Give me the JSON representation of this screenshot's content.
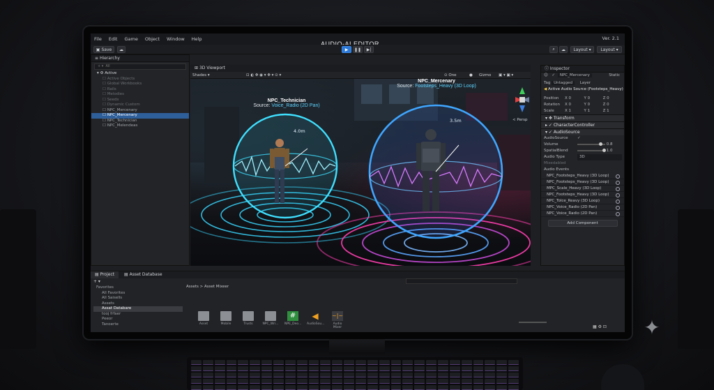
{
  "app": {
    "menu": [
      "File",
      "Edit",
      "Game",
      "Object",
      "Window",
      "Help"
    ],
    "title": "AUDIO-AI EDITOR",
    "version": "Ver. 2.1",
    "save_label": "Save",
    "layout_label": "Layout",
    "layer_label": "Layout"
  },
  "hierarchy": {
    "tab": "Hierarchy",
    "search_placeholder": "All",
    "root": "Active",
    "items": [
      {
        "label": "Active Objects",
        "style": "dim"
      },
      {
        "label": "Global Workbooks",
        "style": "dim"
      },
      {
        "label": "Rails",
        "style": "dim"
      },
      {
        "label": "Melodies",
        "style": "dim"
      },
      {
        "label": "Seeds",
        "style": "dim"
      },
      {
        "label": "Dynamic Custom",
        "style": "dim"
      },
      {
        "label": "NPC_Mercenary",
        "style": ""
      },
      {
        "label": "NPC_Mercenary",
        "style": "sel"
      },
      {
        "label": "NPC_Technician",
        "style": ""
      },
      {
        "label": "NPC_Melendeas",
        "style": ""
      }
    ]
  },
  "viewport": {
    "tab": "3D Viewport",
    "shading": "Shades",
    "tool_one": "One",
    "gizmos": "Gizmo",
    "persp": "< Persp",
    "npc1": {
      "name": "NPC_Technician",
      "source_prefix": "Source: ",
      "source": "Voice_Radio (2D Pan)",
      "distance": "4.0m"
    },
    "npc2": {
      "name": "NPC_Mercenary",
      "source_prefix": "Source: ",
      "source": "Footsteps_Heavy (3D Loop)",
      "distance": "3.5m"
    }
  },
  "inspector": {
    "tab": "Inspector",
    "object_name": "NPC_Mercenary",
    "static_label": "Static",
    "tag_label": "Tag",
    "tag_value": "Untagged",
    "layer_label": "Layer",
    "active_source": "Active Audio Source (Footsteps_Heavy)",
    "position": {
      "label": "Position",
      "x": "0",
      "y": "0",
      "z": "0"
    },
    "rotation": {
      "label": "Rotation",
      "x": "0",
      "y": "0",
      "z": "0"
    },
    "scale": {
      "label": "Scale",
      "x": "1",
      "y": "1",
      "z": "1"
    },
    "components": [
      "Transform",
      "CharacterController",
      "AudioSource"
    ],
    "audio_source_label": "AudioSource",
    "volume_label": "Volume",
    "volume_value": "0.8",
    "spatial_label": "SpatialBlend",
    "spatial_value": "1.0",
    "audio_type_label": "Audio Type",
    "audio_type_value": "3D",
    "mixed_label": "Mixedabled",
    "events_label": "Audio Events",
    "events": [
      "NPC_Footsteps_Heavy (3D Loop)",
      "NPC_Footsteps_Heavy (3D Loop)",
      "MPC_Scale_Heavy (3D Loop)",
      "NPC_Footsteps_Heavy (3D Loop)",
      "NPC_Tolce_Reavy (3D Loop)",
      "NPC_Voice_Radio (2D Pan)",
      "NPC_Voice_Radio (2D Pan)"
    ],
    "add_component": "Add Component"
  },
  "project": {
    "tabs": [
      "Project",
      "Asset Database"
    ],
    "breadcrumb": "Assets > Asset Mixeer",
    "tree": [
      "Favorites",
      "All Favorites",
      "All Saisells",
      "Assets",
      "Assat Databare",
      "tooj frfaer",
      "Peeor",
      "Tanoerte"
    ],
    "assets": [
      {
        "label": "Asset",
        "icon": "folder-icon"
      },
      {
        "label": "Mobile",
        "icon": "folder-icon"
      },
      {
        "label": "Trusts",
        "icon": "folder-icon"
      },
      {
        "label": "NPC_Wri...",
        "icon": "folder-icon"
      },
      {
        "label": "NPE_Deo...",
        "icon": "script-icon"
      },
      {
        "label": "AudioSou...",
        "icon": "speaker-icon"
      },
      {
        "label": "Audio Mixer",
        "icon": "waveform-icon"
      }
    ]
  },
  "colors": {
    "accent": "#2b78d8",
    "sphere_cyan": "#3fe0ff",
    "sphere_blue": "#3f8cff",
    "ring_pink": "#ff3fb0"
  }
}
